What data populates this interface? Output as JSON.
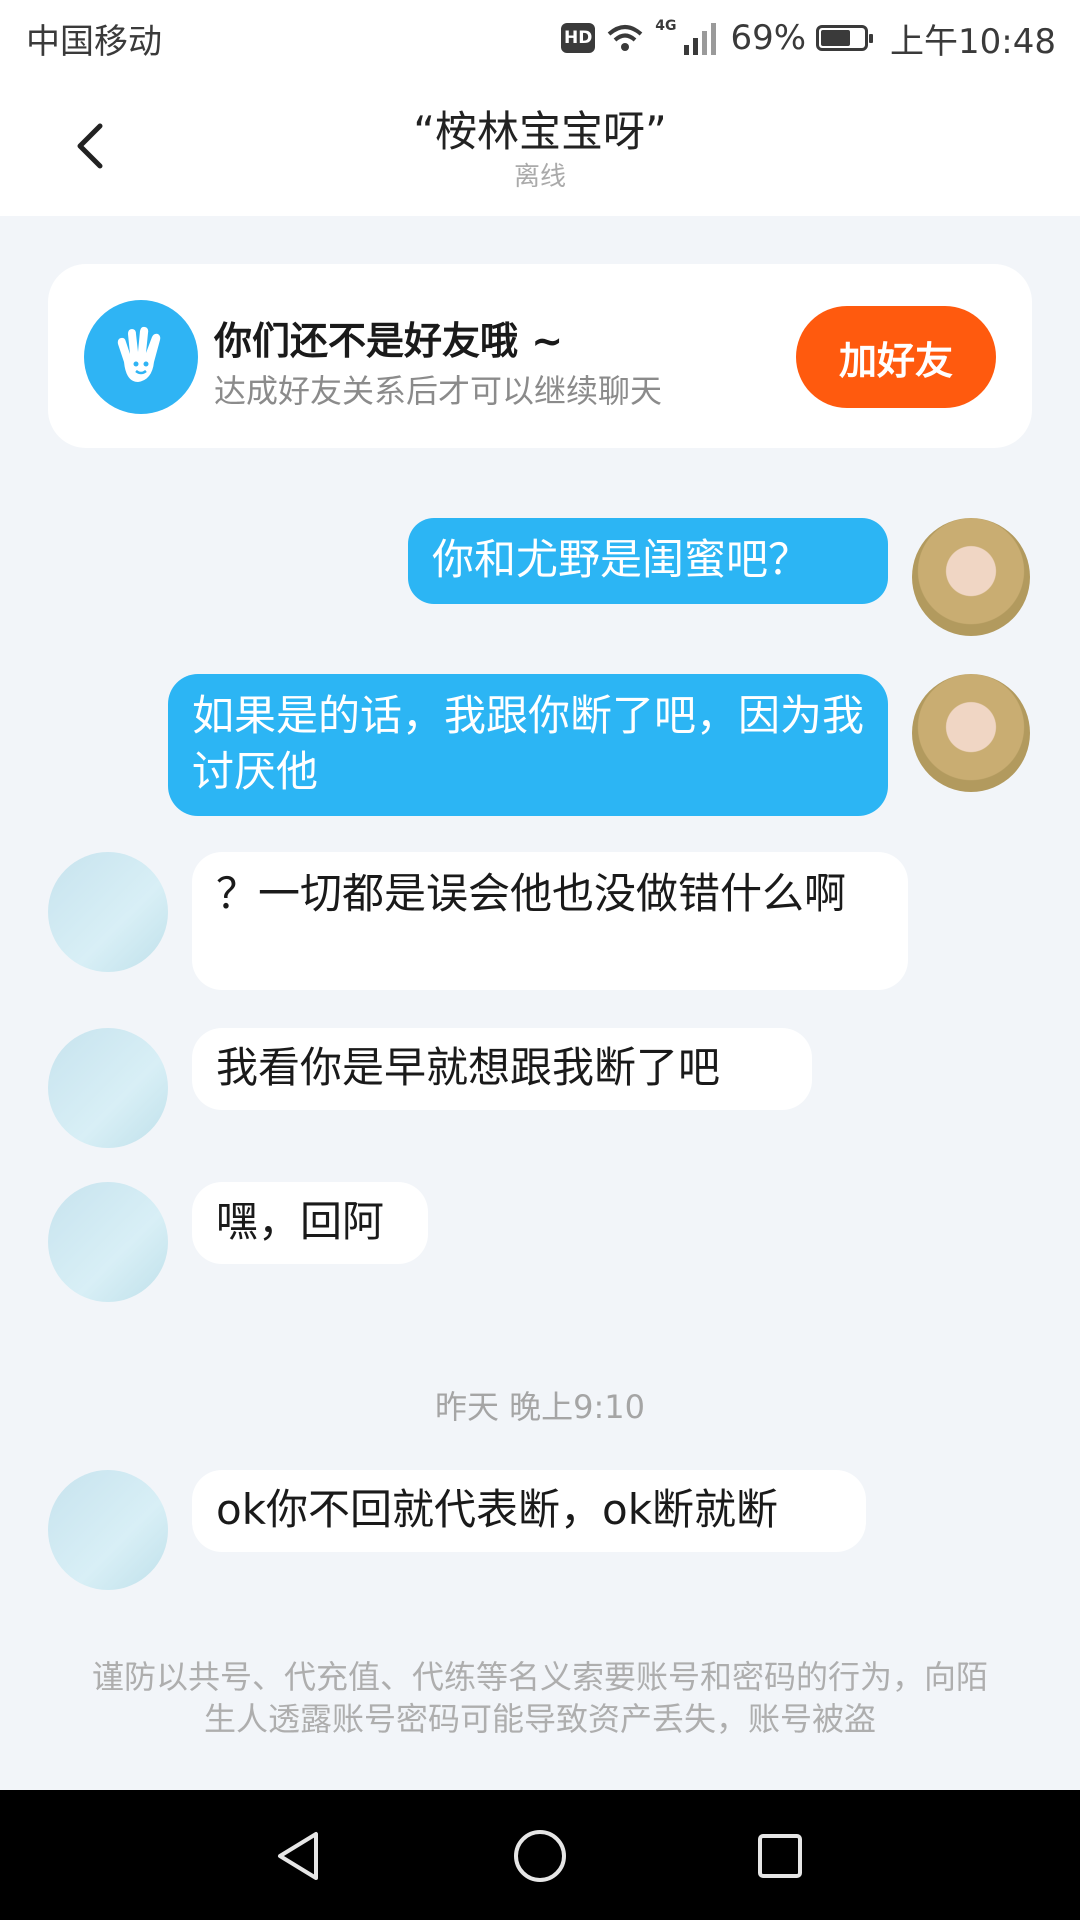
{
  "status_bar": {
    "carrier": "中国移动",
    "hd": "HD",
    "network": "4G",
    "battery_percent": "69%",
    "battery_level": 0.69,
    "time": "上午10:48"
  },
  "header": {
    "title": "“桉林宝宝呀”",
    "status": "离线"
  },
  "friend_card": {
    "title": "你们还不是好友哦 ~",
    "subtitle": "达成好友关系后才可以继续聊天",
    "button": "加好友"
  },
  "messages": [
    {
      "from": "self",
      "text": "你和尤野是闺蜜吧？"
    },
    {
      "from": "self",
      "text": "如果是的话，我跟你断了吧，因为我讨厌他"
    },
    {
      "from": "other",
      "text": "？一切都是误会他也没做错什么啊"
    },
    {
      "from": "other",
      "text": "我看你是早就想跟我断了吧"
    },
    {
      "from": "other",
      "text": "嘿，回阿"
    },
    {
      "from": "other",
      "text": "ok你不回就代表断，ok断就断"
    }
  ],
  "timestamp": "昨天 晚上9:10",
  "warning": "谨防以共号、代充值、代练等名义索要账号和密码的行为，向陌生人透露账号密码可能导致资产丢失，账号被盗",
  "colors": {
    "accent": "#2cb5f4",
    "add_button": "#ff5a0e",
    "background": "#f2f5f9"
  }
}
